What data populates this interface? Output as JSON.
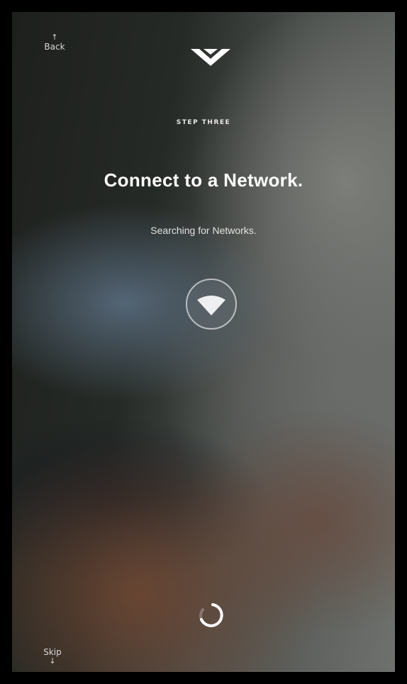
{
  "nav": {
    "back_arrow": "↑",
    "back_label": "Back",
    "skip_label": "Skip",
    "skip_arrow": "↓"
  },
  "logo": {
    "icon": "vizio-v-logo-icon"
  },
  "content": {
    "step_label": "STEP THREE",
    "title": "Connect to a Network.",
    "subtitle": "Searching for Networks."
  },
  "status": {
    "wifi_icon": "wifi-icon",
    "spinner_icon": "loading-spinner-icon"
  },
  "colors": {
    "text_primary": "#ffffff",
    "text_secondary": "#d9d9d9",
    "frame": "#000000"
  }
}
